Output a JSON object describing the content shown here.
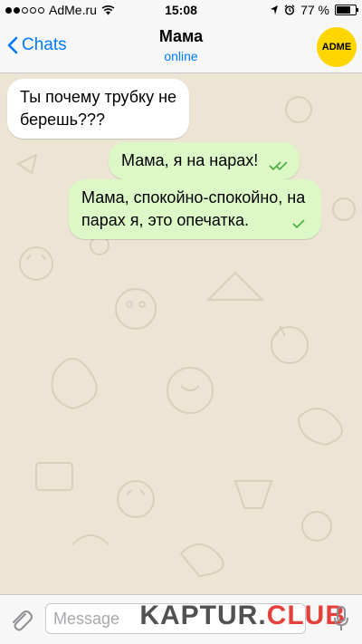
{
  "status_bar": {
    "carrier": "AdMe.ru",
    "time": "15:08",
    "battery": "77 %",
    "battery_level": 0.77,
    "signal_bars_filled": 2,
    "signal_bars_total": 5,
    "icons": [
      "signal-dots",
      "wifi-icon",
      "location-arrow-icon",
      "alarm-icon",
      "battery-icon"
    ]
  },
  "nav": {
    "back_label": "Chats",
    "title": "Мама",
    "subtitle": "online",
    "avatar_text": "ADME"
  },
  "messages": [
    {
      "direction": "in",
      "lines": [
        "Ты почему трубку не",
        "берешь???"
      ]
    },
    {
      "direction": "out",
      "lines": [
        "Мама, я на нарах!"
      ],
      "status": "read"
    },
    {
      "direction": "out",
      "lines": [
        "Мама, спокойно-спокойно, на",
        "парах я, это опечатка."
      ],
      "status": "sent"
    }
  ],
  "input": {
    "placeholder": "Message"
  },
  "watermark": {
    "part1": "KAPTUR.",
    "part2": "CLUB"
  },
  "colors": {
    "accent": "#007aff",
    "incoming_bubble": "#ffffff",
    "outgoing_bubble": "#dcf8c6",
    "tick": "#4cae3f",
    "chat_background": "#ece5d4",
    "avatar": "#ffd600",
    "watermark_club": "#e0211b"
  }
}
